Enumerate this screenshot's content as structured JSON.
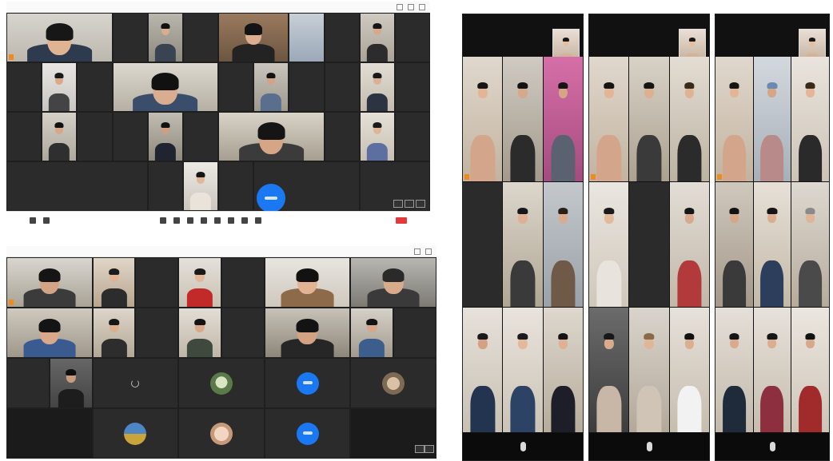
{
  "colors": {
    "meeting_background": "#1f1f1f",
    "accent_blue": "#1a78f2",
    "active_speaker": "#f08a1d",
    "phone_background": "#111111"
  },
  "panels": [
    {
      "id": "top-left",
      "description_icon": "video-meeting-window"
    },
    {
      "id": "bottom-left",
      "description_icon": "video-meeting-window"
    },
    {
      "id": "right",
      "description_icon": "phone-screenshots"
    }
  ],
  "icons": {
    "mic": "mic-icon",
    "avatar": "avatar-icon",
    "toolbar": "toolbar-icon"
  }
}
